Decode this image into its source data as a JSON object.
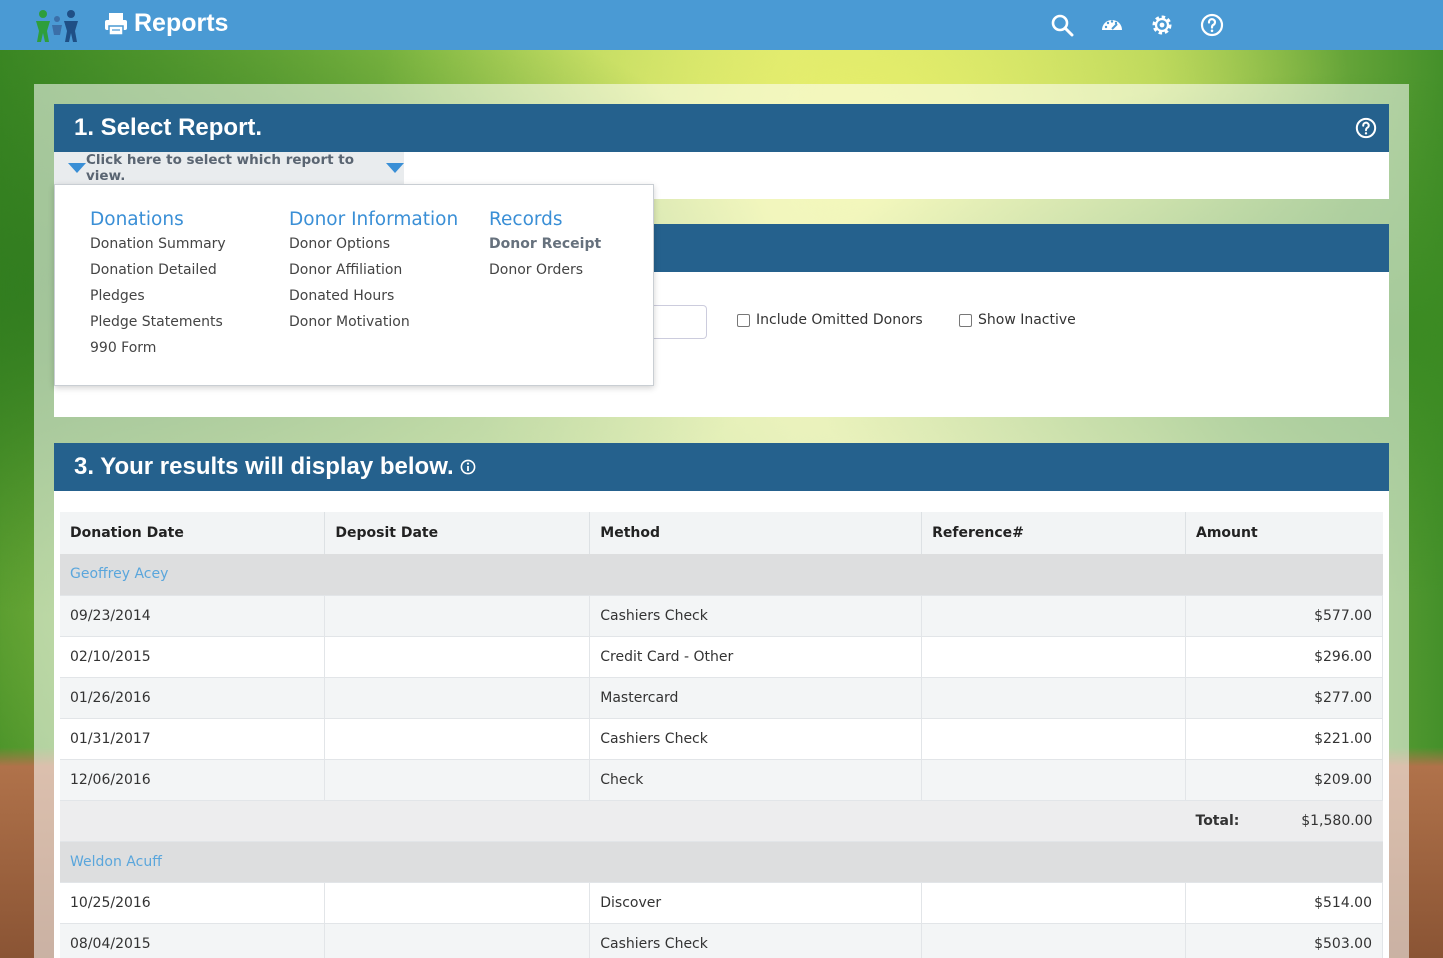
{
  "app": {
    "title": "Reports"
  },
  "header_icons": [
    "search-icon",
    "dashboard-icon",
    "gear-icon",
    "help-icon"
  ],
  "step1": {
    "title": "1. Select Report.",
    "selector_label": "Click here to select which report to view."
  },
  "menu": {
    "columns": [
      {
        "heading": "Donations",
        "items": [
          "Donation Summary",
          "Donation Detailed",
          "Pledges",
          "Pledge Statements",
          "990 Form"
        ]
      },
      {
        "heading": "Donor Information",
        "items": [
          "Donor Options",
          "Donor Affiliation",
          "Donated Hours",
          "Donor Motivation"
        ]
      },
      {
        "heading": "Records",
        "items": [
          "Donor Receipt",
          "Donor Orders"
        ],
        "active": "Donor Receipt"
      }
    ]
  },
  "step2": {
    "include_omitted": "Include Omitted Donors",
    "show_inactive": "Show Inactive"
  },
  "step3": {
    "title": "3. Your results will display below."
  },
  "table": {
    "headers": [
      "Donation Date",
      "Deposit Date",
      "Method",
      "Reference#",
      "Amount"
    ],
    "total_label": "Total:",
    "groups": [
      {
        "name": "Geoffrey Acey",
        "rows": [
          {
            "donation_date": "09/23/2014",
            "deposit_date": "",
            "method": "Cashiers Check",
            "reference": "",
            "amount": "$577.00"
          },
          {
            "donation_date": "02/10/2015",
            "deposit_date": "",
            "method": "Credit Card - Other",
            "reference": "",
            "amount": "$296.00"
          },
          {
            "donation_date": "01/26/2016",
            "deposit_date": "",
            "method": "Mastercard",
            "reference": "",
            "amount": "$277.00"
          },
          {
            "donation_date": "01/31/2017",
            "deposit_date": "",
            "method": "Cashiers Check",
            "reference": "",
            "amount": "$221.00"
          },
          {
            "donation_date": "12/06/2016",
            "deposit_date": "",
            "method": "Check",
            "reference": "",
            "amount": "$209.00"
          }
        ],
        "total": "$1,580.00"
      },
      {
        "name": "Weldon Acuff",
        "rows": [
          {
            "donation_date": "10/25/2016",
            "deposit_date": "",
            "method": "Discover",
            "reference": "",
            "amount": "$514.00"
          },
          {
            "donation_date": "08/04/2015",
            "deposit_date": "",
            "method": "Cashiers Check",
            "reference": "",
            "amount": "$503.00"
          }
        ]
      }
    ]
  }
}
